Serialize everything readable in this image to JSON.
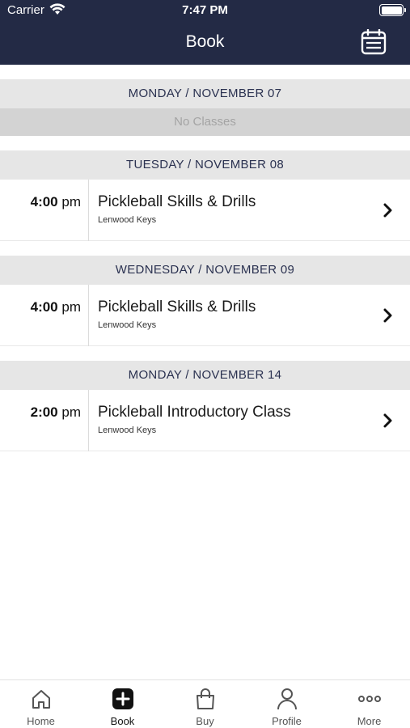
{
  "status_bar": {
    "carrier": "Carrier",
    "time": "7:47 PM"
  },
  "header": {
    "title": "Book",
    "calendar_icon": "calendar-icon"
  },
  "days": [
    {
      "date": "MONDAY / NOVEMBER 07",
      "empty_text": "No Classes",
      "classes": []
    },
    {
      "date": "TUESDAY / NOVEMBER 08",
      "classes": [
        {
          "time": "4:00",
          "meridiem": "pm",
          "name": "Pickleball Skills & Drills",
          "location": "Lenwood Keys"
        }
      ]
    },
    {
      "date": "WEDNESDAY / NOVEMBER 09",
      "classes": [
        {
          "time": "4:00",
          "meridiem": "pm",
          "name": "Pickleball Skills & Drills",
          "location": "Lenwood Keys"
        }
      ]
    },
    {
      "date": "MONDAY / NOVEMBER 14",
      "classes": [
        {
          "time": "2:00",
          "meridiem": "pm",
          "name": "Pickleball Introductory Class",
          "location": "Lenwood Keys"
        }
      ]
    }
  ],
  "tabs": [
    {
      "label": "Home",
      "icon": "home-icon"
    },
    {
      "label": "Book",
      "icon": "plus-square-icon",
      "active": true
    },
    {
      "label": "Buy",
      "icon": "shopping-bag-icon"
    },
    {
      "label": "Profile",
      "icon": "person-icon"
    },
    {
      "label": "More",
      "icon": "more-dots-icon"
    }
  ],
  "colors": {
    "header_bg": "#232a45",
    "day_header_bg": "#e6e6e6",
    "no_classes_bg": "#d3d3d3"
  }
}
